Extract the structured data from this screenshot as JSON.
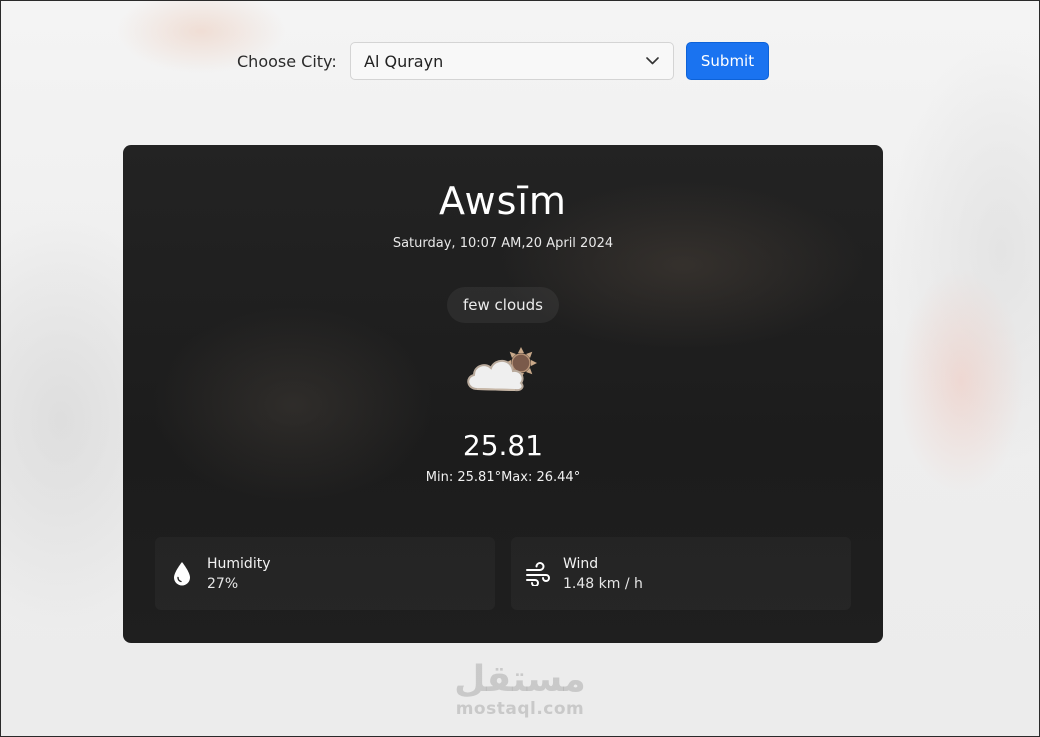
{
  "form": {
    "label": "Choose City:",
    "selected_city": "Al Qurayn",
    "submit_label": "Submit"
  },
  "weather": {
    "city": "Awsīm",
    "datetime": "Saturday, 10:07 AM,20 April 2024",
    "description": "few clouds",
    "icon": "few-clouds-icon",
    "temperature": "25.81",
    "minmax": "Min: 25.81°Max: 26.44°"
  },
  "stats": {
    "humidity": {
      "title": "Humidity",
      "value": "27%",
      "icon": "water-drop-icon"
    },
    "wind": {
      "title": "Wind",
      "value": "1.48 km / h",
      "icon": "wind-icon"
    }
  },
  "watermark": {
    "logo": "مستقل",
    "url": "mostaql.com"
  },
  "colors": {
    "accent": "#1a73f0",
    "card_bg": "#1f1f1f",
    "page_bg": "#f0f0f0"
  }
}
